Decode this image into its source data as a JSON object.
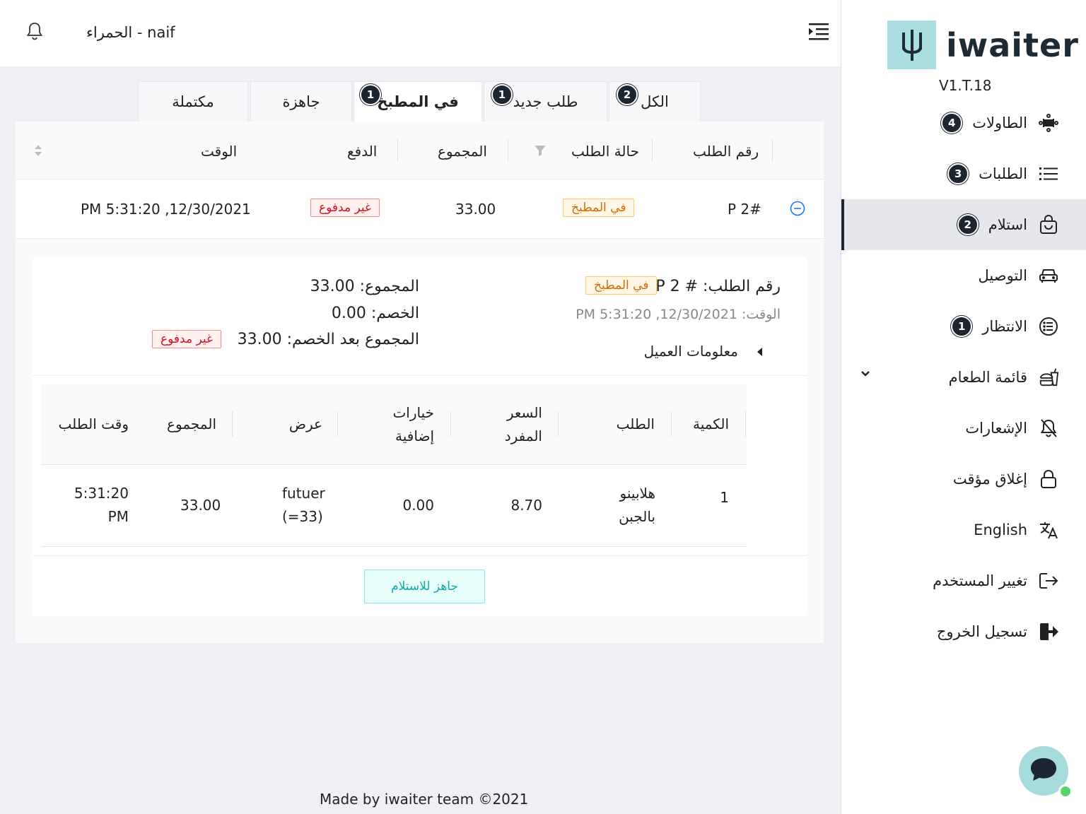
{
  "app": {
    "logo_text": "iwaiter",
    "version": "V1.T.18",
    "brand_color": "#a9dde1",
    "dark_color": "#1c2530"
  },
  "header": {
    "user": "الحمراء - naif"
  },
  "sidebar": {
    "items": [
      {
        "label": "الطاولات",
        "icon": "tables-icon",
        "badge": "4"
      },
      {
        "label": "الطلبات",
        "icon": "list-icon",
        "badge": "3"
      },
      {
        "label": "استلام",
        "icon": "shopping-bag-icon",
        "badge": "2",
        "active": true
      },
      {
        "label": "التوصيل",
        "icon": "car-icon",
        "badge": ""
      },
      {
        "label": "الانتظار",
        "icon": "queue-icon",
        "badge": "1"
      },
      {
        "label": "قائمة الطعام",
        "icon": "food-icon",
        "badge": ""
      },
      {
        "label": "الإشعارات",
        "icon": "bell-off-icon",
        "badge": ""
      },
      {
        "label": "إغلاق مؤقت",
        "icon": "lock-icon",
        "badge": ""
      },
      {
        "label": "English",
        "icon": "translate-icon",
        "badge": ""
      },
      {
        "label": "تغيير المستخدم",
        "icon": "switch-user-icon",
        "badge": ""
      },
      {
        "label": "تسجيل الخروج",
        "icon": "logout-icon",
        "badge": ""
      }
    ]
  },
  "tabs": [
    {
      "label": "الكل",
      "badge": "2"
    },
    {
      "label": "طلب جديد",
      "badge": "1"
    },
    {
      "label": "في المطبخ",
      "badge": "1",
      "active": true
    },
    {
      "label": "جاهزة",
      "badge": ""
    },
    {
      "label": "مكتملة",
      "badge": ""
    }
  ],
  "orders_table": {
    "columns": {
      "order_no": "رقم الطلب",
      "status": "حالة الطلب",
      "total": "المجموع",
      "payment": "الدفع",
      "time": "الوقت"
    },
    "rows": [
      {
        "order_no": "P 2#",
        "status": "في المطبخ",
        "total": "33.00",
        "payment": "غير مدفوع",
        "time": "PM 5:31:20 ,12/30/2021"
      }
    ]
  },
  "detail": {
    "order_no": "رقم الطلب: # P 2",
    "status": "في المطبخ",
    "time": "الوقت: PM 5:31:20 ,12/30/2021",
    "customer_info": "معلومات العميل",
    "total": "المجموع: 33.00",
    "discount": "الخصم: 0.00",
    "total_after_discount": "المجموع بعد الخصم: 33.00",
    "payment": "غير مدفوع",
    "items_columns": {
      "qty": "الكمية",
      "item": "الطلب",
      "unit_price_1": "السعر",
      "unit_price_2": "المفرد",
      "extras_1": "خيارات",
      "extras_2": "إضافية",
      "offer": "عرض",
      "total": "المجموع",
      "order_time": "وقت الطلب"
    },
    "items": [
      {
        "qty": "1",
        "item_1": "هلابينو",
        "item_2": "بالجبن",
        "unit_price": "8.70",
        "extras": "0.00",
        "offer_1": "futuer",
        "offer_2": "(=33)",
        "total": "33.00",
        "time_1": "5:31:20",
        "time_2": "PM"
      }
    ],
    "ready_button": "جاهز للاستلام"
  },
  "footer": {
    "text": "Made by iwaiter team ©2021"
  }
}
